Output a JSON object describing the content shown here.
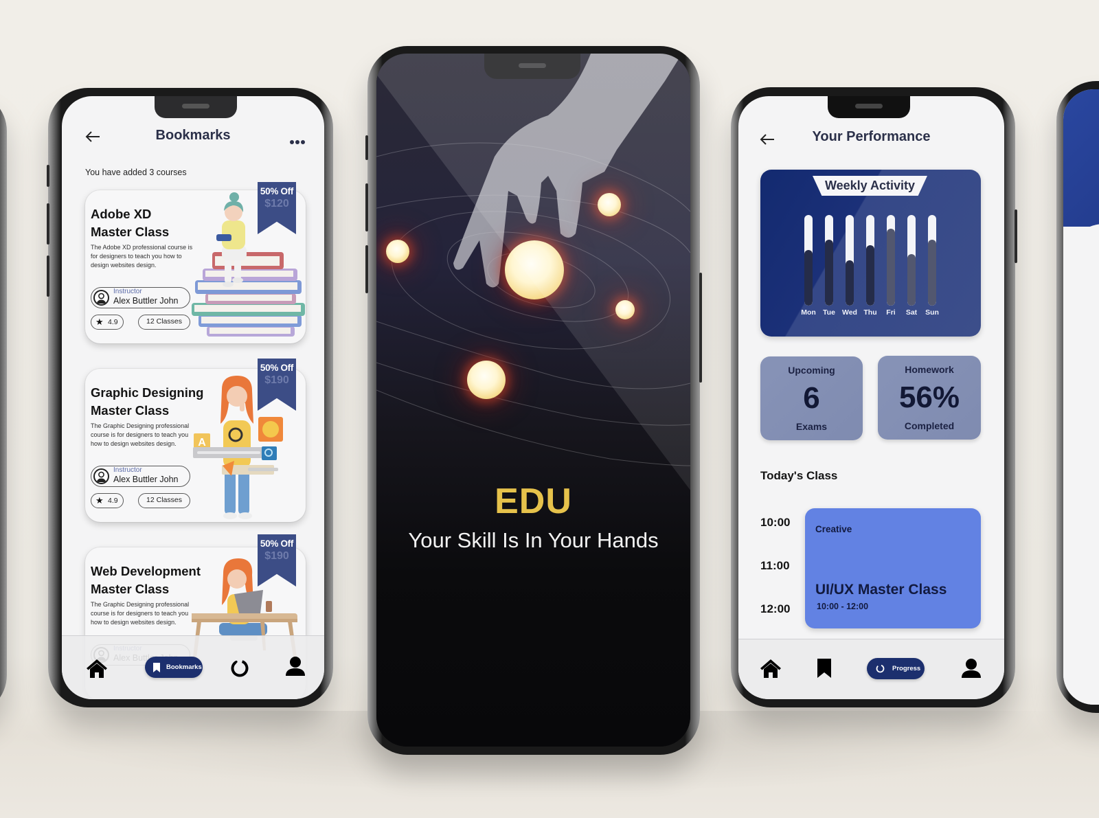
{
  "colors": {
    "background": "#efece5",
    "accent_navy": "#1c2f6e",
    "ribbon": "#3c4d86",
    "brand_gold": "#e6c24b",
    "stat_card": "#8591b5",
    "class_card": "#6282e3"
  },
  "left_phone": {
    "header": {
      "back_icon": "arrow-left-icon",
      "title": "Bookmarks",
      "more_icon": "more-dots-icon"
    },
    "subtitle": "You have added 3 courses",
    "courses": [
      {
        "title_line1": "Adobe XD",
        "title_line2": "Master Class",
        "description": "The Adobe XD professional course is for designers to teach you how to design websites design.",
        "instructor_label": "Instructor",
        "instructor_name": "Alex Buttler John",
        "rating": "4.9",
        "classes": "12 Classes",
        "discount": "50% Off",
        "price": "$120"
      },
      {
        "title_line1": "Graphic Designing",
        "title_line2": "Master Class",
        "description": "The Graphic Designing professional course is for designers to teach you how to design websites design.",
        "instructor_label": "Instructor",
        "instructor_name": "Alex Buttler John",
        "rating": "4.9",
        "classes": "12 Classes",
        "discount": "50% Off",
        "price": "$190"
      },
      {
        "title_line1": "Web Development",
        "title_line2": "Master Class",
        "description": "The Graphic Designing professional course is for designers to teach you how to design websites design.",
        "instructor_label": "Instructor",
        "instructor_name": "Alex Buttler John",
        "discount": "50% Off",
        "price": "$190"
      }
    ],
    "nav": {
      "home_icon": "home-icon",
      "bookmarks_label": "Bookmarks",
      "progress_icon": "progress-ring-icon",
      "profile_icon": "user-icon",
      "active": "Bookmarks"
    }
  },
  "center_phone": {
    "brand": "EDU",
    "tagline": "Your Skill Is In Your Hands"
  },
  "right_phone": {
    "header": {
      "back_icon": "arrow-left-icon",
      "title": "Your Performance"
    },
    "weekly_activity": {
      "title": "Weekly Activity",
      "days": [
        "Mon",
        "Tue",
        "Wed",
        "Thu",
        "Fri",
        "Sat",
        "Sun"
      ],
      "values": [
        0.61,
        0.73,
        0.5,
        0.67,
        0.85,
        0.57,
        0.73
      ]
    },
    "stats": [
      {
        "label": "Upcoming",
        "value": "6",
        "caption": "Exams"
      },
      {
        "label": "Homework",
        "value": "56%",
        "caption": "Completed"
      }
    ],
    "todays_class": {
      "heading": "Today's Class",
      "times": [
        "10:00",
        "11:00",
        "12:00"
      ],
      "card": {
        "category": "Creative",
        "title": "UI/UX Master Class",
        "time_range": "10:00 - 12:00"
      }
    },
    "nav": {
      "home_icon": "home-icon",
      "bookmark_icon": "bookmark-icon",
      "progress_label": "Progress",
      "profile_icon": "user-icon",
      "active": "Progress"
    }
  }
}
